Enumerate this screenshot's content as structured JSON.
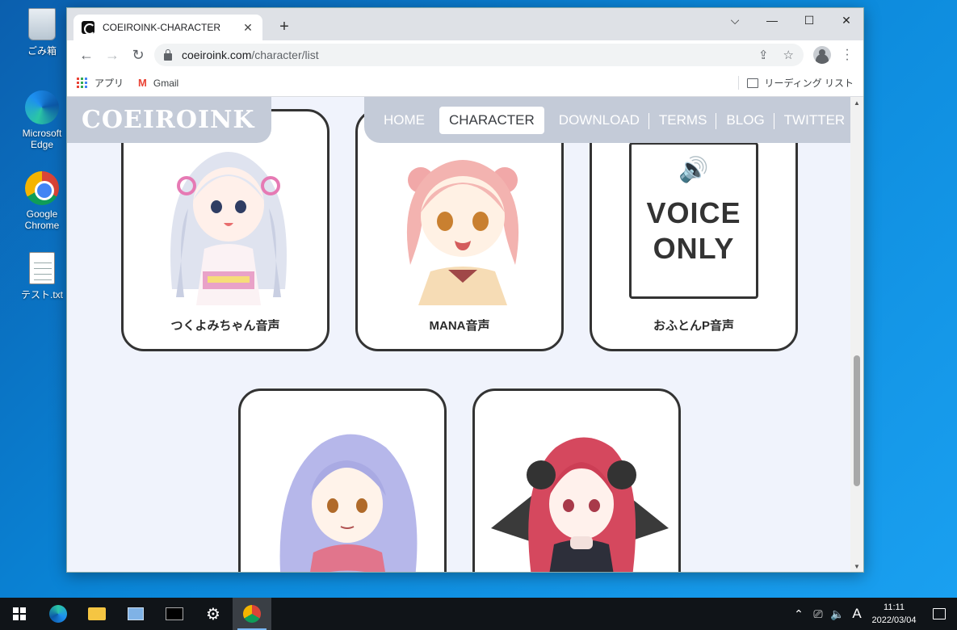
{
  "desktop": {
    "icons": [
      {
        "label": "ごみ箱",
        "icon": "recycle-bin-icon"
      },
      {
        "label": "Microsoft Edge",
        "icon": "edge-icon"
      },
      {
        "label": "Google Chrome",
        "icon": "chrome-icon"
      },
      {
        "label": "テスト.txt",
        "icon": "text-file-icon"
      }
    ]
  },
  "browser": {
    "tab_title": "COEIROINK-CHARACTER",
    "tab_close": "✕",
    "new_tab": "+",
    "window_controls": {
      "tab_search": "⌵",
      "minimize": "—",
      "maximize": "☐",
      "close": "✕"
    },
    "url_host": "coeiroink.com",
    "url_path": "/character/list",
    "bookmarks": {
      "apps": "アプリ",
      "gmail": "Gmail",
      "reading_list": "リーディング リスト"
    }
  },
  "site": {
    "logo": "COEIROINK",
    "nav": [
      "HOME",
      "CHARACTER",
      "DOWNLOAD",
      "TERMS",
      "BLOG",
      "TWITTER"
    ],
    "active_nav": "CHARACTER",
    "characters": [
      {
        "name": "つくよみちゃん音声"
      },
      {
        "name": "MANA音声"
      },
      {
        "name": "おふとんP音声"
      },
      {
        "name": ""
      },
      {
        "name": ""
      }
    ],
    "voice_only_line1": "VOICE",
    "voice_only_line2": "ONLY"
  },
  "taskbar": {
    "time": "11:11",
    "date": "2022/03/04",
    "ime": "A"
  },
  "colors": {
    "header_bg": "#c4cbd8",
    "page_bg": "#f0f3fc",
    "card_border": "#333333",
    "desktop_blue": "#0a86d8"
  }
}
